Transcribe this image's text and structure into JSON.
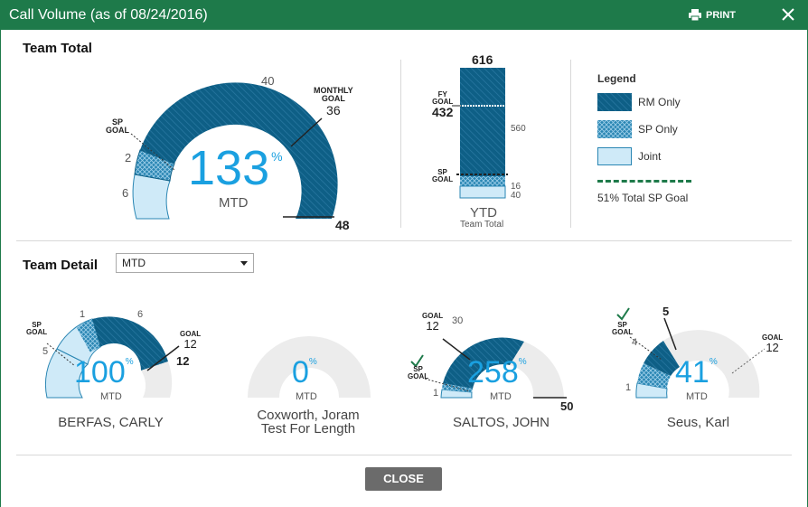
{
  "window": {
    "title": "Call Volume (as of 08/24/2016)",
    "print_label": "PRINT",
    "close_label": "CLOSE"
  },
  "team_total": {
    "heading": "Team Total",
    "percent": "133",
    "percent_sign": "%",
    "period": "MTD",
    "scale_label": "40",
    "sp_goal_label_1": "SP",
    "sp_goal_label_2": "GOAL",
    "monthly_goal_label_1": "MONTHLY",
    "monthly_goal_label_2": "GOAL",
    "monthly_goal_value": "36",
    "total_value": "48",
    "sp_only_value": "2",
    "joint_value": "6"
  },
  "ytd": {
    "total": "616",
    "fy_goal_label_1": "FY",
    "fy_goal_label_2": "GOAL",
    "fy_goal_value": "432",
    "rm_only": "560",
    "sp_goal_label_1": "SP",
    "sp_goal_label_2": "GOAL",
    "sp_only": "16",
    "joint": "40",
    "label": "YTD",
    "sublabel": "Team Total"
  },
  "legend": {
    "title": "Legend",
    "items": [
      {
        "label": "RM Only",
        "color": "#0e5f86"
      },
      {
        "label": "SP Only",
        "color": "#2a86b3"
      },
      {
        "label": "Joint",
        "color": "#cfeaf8"
      }
    ],
    "goal_label": "51% Total SP Goal",
    "goal_color": "#1e7a4a"
  },
  "team_detail": {
    "heading": "Team Detail",
    "period_select": "MTD",
    "members": [
      {
        "name_line1": "BERFAS, CARLY",
        "name_line2": "",
        "percent": "100",
        "period": "MTD",
        "val_a": "1",
        "val_b": "6",
        "val_c": "5",
        "goal_label": "GOAL",
        "goal_value": "12",
        "total": "12",
        "sp_goal_1": "SP",
        "sp_goal_2": "GOAL"
      },
      {
        "name_line1": "Coxworth, Joram",
        "name_line2": "Test For Length",
        "percent": "0",
        "period": "MTD"
      },
      {
        "name_line1": "SALTOS, JOHN",
        "name_line2": "",
        "percent": "258",
        "period": "MTD",
        "goal_label": "GOAL",
        "goal_value": "12",
        "val_b": "30",
        "val_c": "1",
        "total": "50",
        "sp_goal_1": "SP",
        "sp_goal_2": "GOAL"
      },
      {
        "name_line1": "Seus, Karl",
        "name_line2": "",
        "percent": "41",
        "period": "MTD",
        "val_a": "5",
        "val_b": "4",
        "val_c": "1",
        "goal_label": "GOAL",
        "goal_value": "12",
        "sp_goal_1": "SP",
        "sp_goal_2": "GOAL"
      }
    ]
  },
  "colors": {
    "header": "#1e7a4a",
    "rm_only": "#0e5f86",
    "sp_only": "#2a86b3",
    "joint": "#cfeaf8",
    "percent_text": "#1aa0e0",
    "gauge_bg": "#ececec",
    "check": "#1e7a4a"
  }
}
